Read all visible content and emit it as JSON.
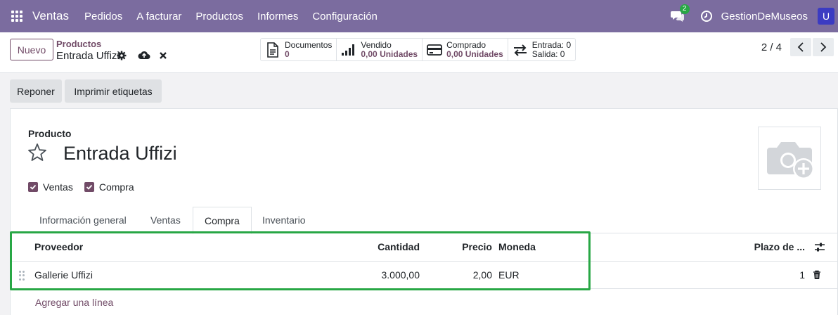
{
  "navbar": {
    "brand": "Ventas",
    "menu": [
      "Pedidos",
      "A facturar",
      "Productos",
      "Informes",
      "Configuración"
    ],
    "chat_count": "2",
    "company": "GestionDeMuseos",
    "avatar_initial": "U"
  },
  "control": {
    "new_label": "Nuevo",
    "breadcrumb_parent": "Productos",
    "record_name": "Entrada Uffizi",
    "smart_buttons": [
      {
        "label": "Documentos",
        "value": "0",
        "icon": "file-icon"
      },
      {
        "label": "Vendido",
        "value": "0,00 Unidades",
        "icon": "bar-chart-icon"
      },
      {
        "label": "Comprado",
        "value": "0,00 Unidades",
        "icon": "credit-card-icon"
      },
      {
        "label": "Entrada: 0",
        "value": "Salida: 0",
        "icon": "exchange-icon"
      }
    ],
    "pager": "2 / 4"
  },
  "actions": {
    "replenish": "Reponer",
    "print_labels": "Imprimir etiquetas"
  },
  "form": {
    "product_label": "Producto",
    "product_name": "Entrada Uffizi",
    "checkboxes": [
      {
        "label": "Ventas",
        "checked": true
      },
      {
        "label": "Compra",
        "checked": true
      }
    ],
    "tabs": [
      "Información general",
      "Ventas",
      "Compra",
      "Inventario"
    ],
    "active_tab": "Compra"
  },
  "vendor_table": {
    "headers": {
      "vendor": "Proveedor",
      "quantity": "Cantidad",
      "price": "Precio",
      "currency": "Moneda",
      "lead_time": "Plazo de ..."
    },
    "rows": [
      {
        "vendor": "Gallerie Uffizi",
        "quantity": "3.000,00",
        "price": "2,00",
        "currency": "EUR",
        "lead_time": "1"
      }
    ],
    "add_line": "Agregar una línea"
  },
  "colors": {
    "navbar": "#7b6c9f",
    "primary": "#714b67",
    "highlight": "#28a745"
  }
}
